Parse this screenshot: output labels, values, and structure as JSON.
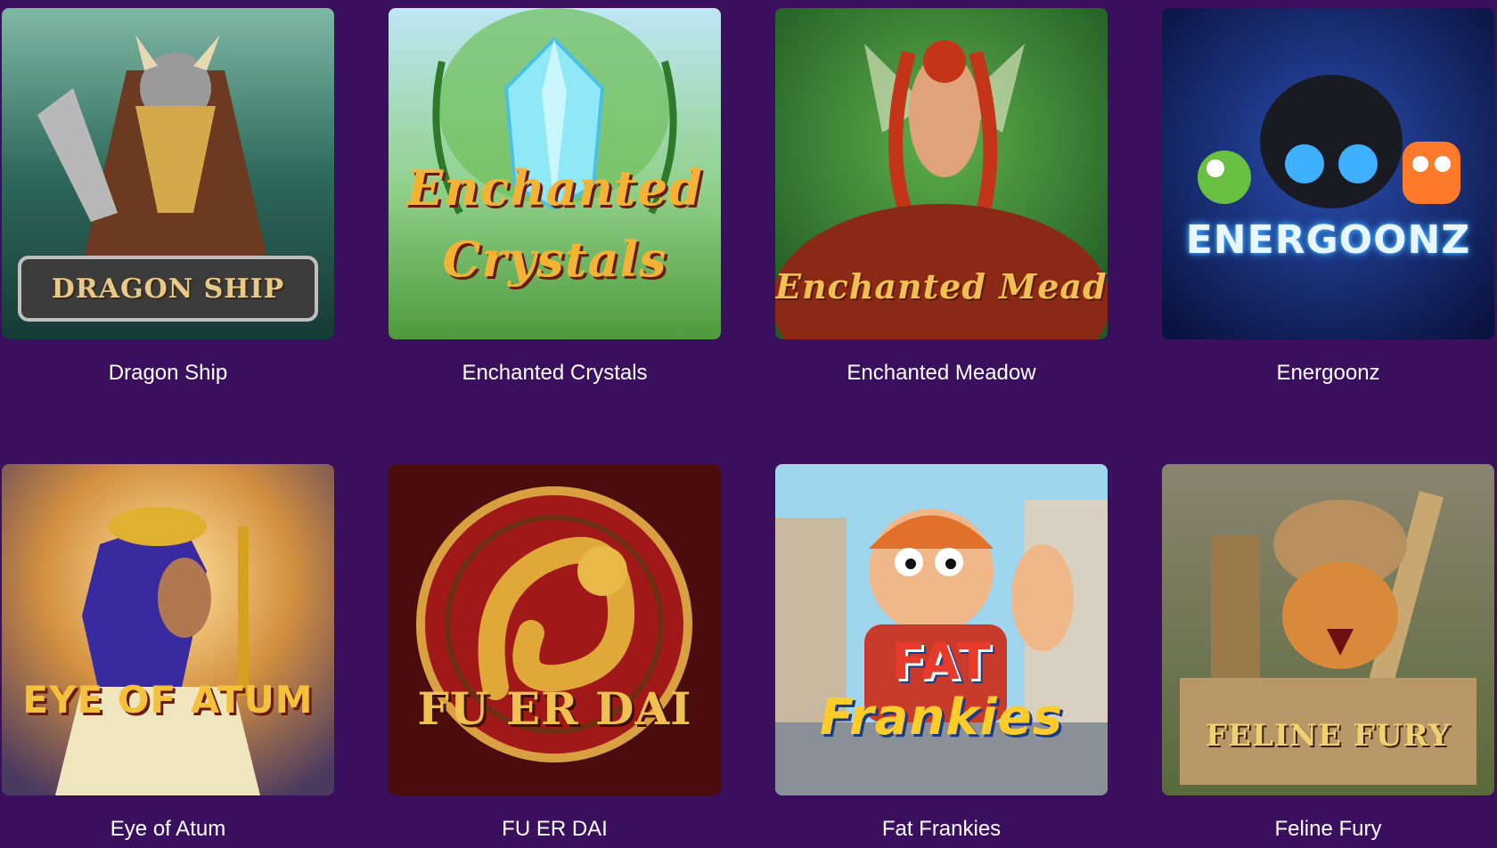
{
  "games": [
    {
      "title": "Dragon Ship",
      "logo": "DRAGON SHIP"
    },
    {
      "title": "Enchanted Crystals",
      "logo_line1": "Enchanted",
      "logo_line2": "Crystals"
    },
    {
      "title": "Enchanted Meadow",
      "logo": "Enchanted Meadow"
    },
    {
      "title": "Energoonz",
      "logo": "ENERGOONZ"
    },
    {
      "title": "Eye of Atum",
      "logo": "EYE OF ATUM"
    },
    {
      "title": "FU ER DAI",
      "logo": "FU ER DAI"
    },
    {
      "title": "Fat Frankies",
      "logo_line1": "FAT",
      "logo_line2": "Frankies"
    },
    {
      "title": "Feline Fury",
      "logo": "FELINE FURY"
    }
  ],
  "colors": {
    "page_background": "#3a0f5e",
    "caption_text": "#ffffff"
  }
}
